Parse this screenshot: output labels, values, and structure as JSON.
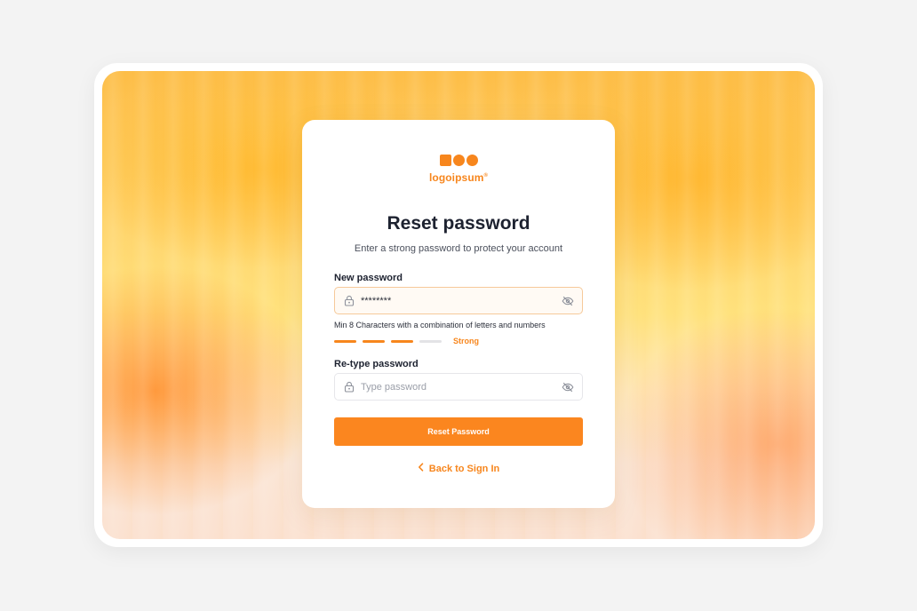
{
  "brand": {
    "name": "logoipsum",
    "mark": "®",
    "accent": "#f7861d"
  },
  "reset_form": {
    "title": "Reset password",
    "subtitle": "Enter a strong password to protect your account",
    "new_password": {
      "label": "New password",
      "value": "********",
      "icon": "lock-icon",
      "toggle_icon": "eye-off-icon"
    },
    "hint": "Min 8 Characters with a combination of letters and numbers",
    "strength": {
      "level": 3,
      "max": 4,
      "label": "Strong"
    },
    "retype_password": {
      "label": "Re-type password",
      "placeholder": "Type password",
      "icon": "lock-icon",
      "toggle_icon": "eye-off-icon"
    },
    "submit_label": "Reset Password",
    "back_label": "Back to Sign In",
    "back_icon": "chevron-left-icon"
  }
}
